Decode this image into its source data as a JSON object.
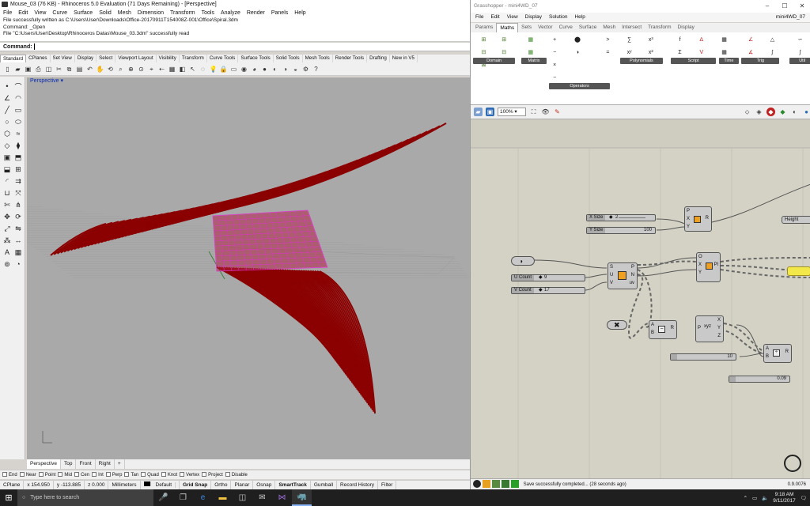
{
  "rhino": {
    "title": "Mouse_03 (76 KB) - Rhinoceros 5.0 Evaluation (71 Days Remaining) - [Perspective]",
    "menu": [
      "File",
      "Edit",
      "View",
      "Curve",
      "Surface",
      "Solid",
      "Mesh",
      "Dimension",
      "Transform",
      "Tools",
      "Analyze",
      "Render",
      "Panels",
      "Help"
    ],
    "history": [
      "File successfully written as C:\\Users\\User\\Downloads\\Office-20170911T154008Z-001\\Office\\Spiral.3dm",
      "Command: _Open",
      "File \"C:\\Users\\User\\Desktop\\Rhinoceros Datas\\Mouse_03.3dm\" successfully read"
    ],
    "command_label": "Command:",
    "toolbar_tabs": [
      "Standard",
      "CPlanes",
      "Set View",
      "Display",
      "Select",
      "Viewport Layout",
      "Visibility",
      "Transform",
      "Curve Tools",
      "Surface Tools",
      "Solid Tools",
      "Mesh Tools",
      "Render Tools",
      "Drafting",
      "New in V5"
    ],
    "viewport_title": "Perspective",
    "viewport_tabs": [
      "Perspective",
      "Top",
      "Front",
      "Right"
    ],
    "viewport_add": "+",
    "osnaps": [
      "End",
      "Near",
      "Point",
      "Mid",
      "Cen",
      "Int",
      "Perp",
      "Tan",
      "Quad",
      "Knot",
      "Vertex",
      "Project",
      "Disable"
    ],
    "status": {
      "cplane": "CPlane",
      "x": "x 154.950",
      "y": "y -113.885",
      "z": "z 0.000",
      "units": "Millimeters",
      "layer": "Default",
      "modes": [
        "Grid Snap",
        "Ortho",
        "Planar",
        "Osnap",
        "SmartTrack",
        "Gumball",
        "Record History",
        "Filter"
      ]
    }
  },
  "gh": {
    "title": "Grasshopper - mini4WD_07",
    "doc": "mini4WD_07",
    "menu": [
      "File",
      "Edit",
      "View",
      "Display",
      "Solution",
      "Help"
    ],
    "tabs": [
      "Params",
      "Maths",
      "Sets",
      "Vector",
      "Curve",
      "Surface",
      "Mesh",
      "Intersect",
      "Transform",
      "Display"
    ],
    "groups": [
      "Domain",
      "Matrix",
      "Operators",
      "Polynomials",
      "Script",
      "Time",
      "Trig",
      "Util"
    ],
    "zoom": "100%",
    "sliders": {
      "xsize_label": "X Size",
      "xsize_value": "2",
      "ysize_label": "Y Size",
      "ysize_value": "100",
      "ucount_label": "U Count",
      "ucount_value": "9",
      "vcount_label": "V Count",
      "vcount_value": "17",
      "s10_value": "10",
      "s009_value": "0.09"
    },
    "height_label": "Height",
    "status_msg": "Save successfully completed... (28 seconds ago)",
    "version": "0.9.0076"
  },
  "taskbar": {
    "search_placeholder": "Type here to search",
    "time": "9:18 AM",
    "date": "9/11/2017"
  }
}
